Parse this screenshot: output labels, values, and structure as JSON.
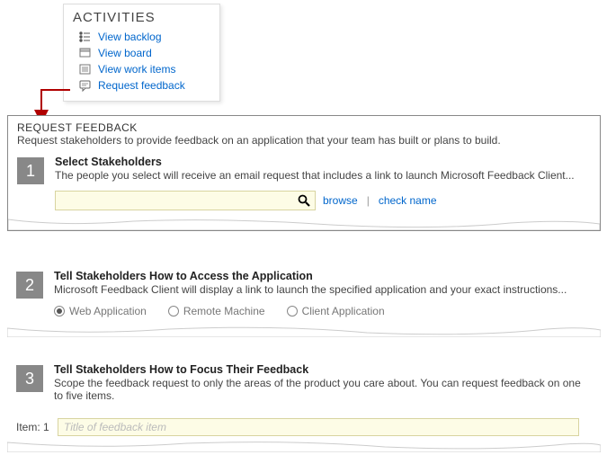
{
  "activities": {
    "title": "ACTIVITIES",
    "items": [
      {
        "label": "View backlog"
      },
      {
        "label": "View board"
      },
      {
        "label": "View work items"
      },
      {
        "label": "Request feedback"
      }
    ]
  },
  "form": {
    "title": "REQUEST FEEDBACK",
    "subtitle": "Request stakeholders to provide feedback on an application that your team has built or plans to build.",
    "step1": {
      "num": "1",
      "heading": "Select Stakeholders",
      "desc": "The people you select will receive an email request that includes a link to launch Microsoft Feedback Client...",
      "browse": "browse",
      "check": "check name"
    },
    "step2": {
      "num": "2",
      "heading": "Tell Stakeholders How to Access the Application",
      "desc": "Microsoft Feedback Client will display a link to launch the specified application and your exact instructions...",
      "opt_web": "Web Application",
      "opt_remote": "Remote Machine",
      "opt_client": "Client Application"
    },
    "step3": {
      "num": "3",
      "heading": "Tell Stakeholders How to Focus Their Feedback",
      "desc": "Scope the feedback request to only the areas of the product you care about. You can request feedback on one to five items.",
      "item_label": "Item: 1",
      "item_placeholder": "Title of feedback item"
    }
  }
}
